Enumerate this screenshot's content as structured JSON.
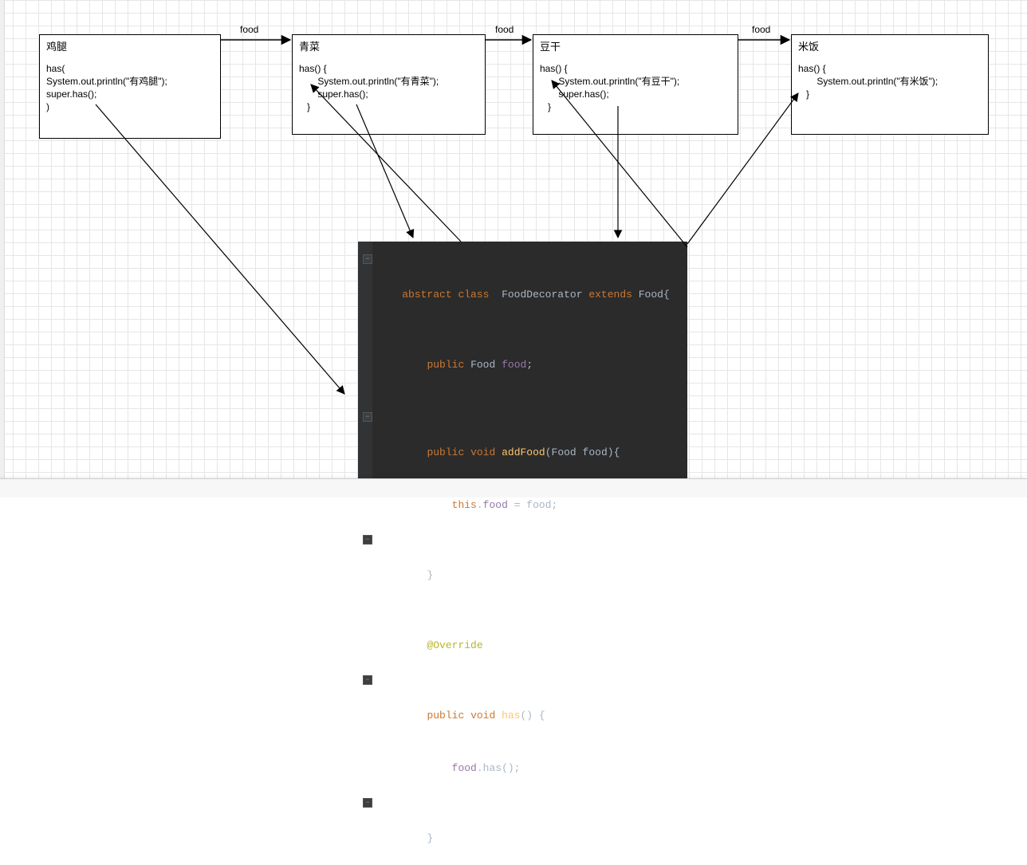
{
  "nodes": {
    "n1": {
      "title": "鸡腿",
      "body": "has(\nSystem.out.println(\"有鸡腿\");\nsuper.has();\n)"
    },
    "n2": {
      "title": "青菜",
      "body": "has() {\n       System.out.println(\"有青菜\");\n       super.has();\n   }"
    },
    "n3": {
      "title": "豆干",
      "body": "has() {\n       System.out.println(\"有豆干\");\n       super.has();\n   }"
    },
    "n4": {
      "title": "米饭",
      "body": "has() {\n       System.out.println(\"有米饭\");\n   }"
    }
  },
  "edge_labels": {
    "e12": "food",
    "e23": "food",
    "e34": "food"
  },
  "code": {
    "l1": {
      "abstract": "abstract",
      "class": "class",
      "name": "FoodDecorator",
      "extends": "extends",
      "super": "Food",
      "brace": "{"
    },
    "l2": {
      "public": "public",
      "type": "Food",
      "field": "food",
      "semi": ";"
    },
    "l3": {
      "public": "public",
      "void": "void",
      "method": "addFood",
      "param_type": "Food",
      "param": "food",
      "brace": "{"
    },
    "l4": {
      "this": "this",
      "field": "food",
      "eq": " = ",
      "rhs": "food",
      "semi": ";"
    },
    "l5": {
      "brace": "}"
    },
    "l6": {
      "anno": "@Override"
    },
    "l7": {
      "public": "public",
      "void": "void",
      "method": "has",
      "parens": "()",
      "brace": " {"
    },
    "l8": {
      "recv": "food",
      "call": "has",
      "parens": "();"
    },
    "l9": {
      "brace": "}"
    }
  }
}
